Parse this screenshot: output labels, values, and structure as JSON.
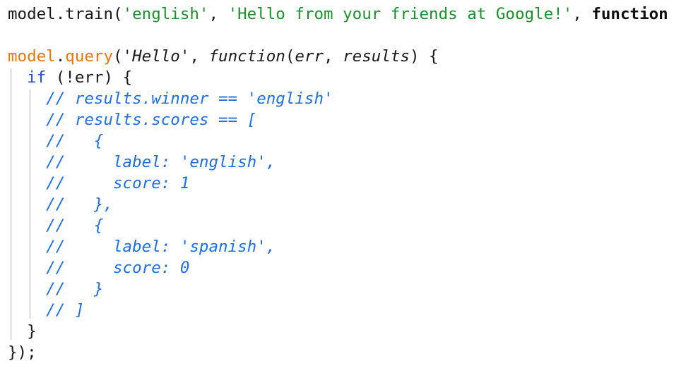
{
  "editor": {
    "lines": [
      {
        "parts": [
          {
            "text": "model.train(",
            "style": "plain"
          },
          {
            "text": "'english'",
            "style": "str"
          },
          {
            "text": ", ",
            "style": "plain"
          },
          {
            "text": "'Hello from your friends at Google!'",
            "style": "str"
          },
          {
            "text": ", ",
            "style": "plain"
          },
          {
            "text": "function",
            "style": "bold"
          }
        ]
      },
      {
        "parts": []
      },
      {
        "parts": [
          {
            "text": "model",
            "style": "fn-call"
          },
          {
            "text": ".",
            "style": "plain"
          },
          {
            "text": "query",
            "style": "fn-call"
          },
          {
            "text": "('",
            "style": "plain"
          },
          {
            "text": "Hello",
            "style": "ital"
          },
          {
            "text": "', ",
            "style": "plain"
          },
          {
            "text": "function",
            "style": "ital"
          },
          {
            "text": "(",
            "style": "plain"
          },
          {
            "text": "err",
            "style": "ital"
          },
          {
            "text": ", ",
            "style": "plain"
          },
          {
            "text": "results",
            "style": "ital"
          },
          {
            "text": ") {",
            "style": "plain"
          }
        ]
      },
      {
        "parts": [
          {
            "text": "  ",
            "style": "plain"
          },
          {
            "text": "if",
            "style": "kw"
          },
          {
            "text": " (!err) {",
            "style": "plain"
          }
        ]
      },
      {
        "parts": [
          {
            "text": "    // results.winner == 'english'",
            "style": "cmt"
          }
        ]
      },
      {
        "parts": [
          {
            "text": "    // results.scores == [",
            "style": "cmt"
          }
        ]
      },
      {
        "parts": [
          {
            "text": "    //   {",
            "style": "cmt"
          }
        ]
      },
      {
        "parts": [
          {
            "text": "    //     label: 'english',",
            "style": "cmt"
          }
        ]
      },
      {
        "parts": [
          {
            "text": "    //     score: 1",
            "style": "cmt"
          }
        ]
      },
      {
        "parts": [
          {
            "text": "    //   },",
            "style": "cmt"
          }
        ]
      },
      {
        "parts": [
          {
            "text": "    //   {",
            "style": "cmt"
          }
        ]
      },
      {
        "parts": [
          {
            "text": "    //     label: 'spanish',",
            "style": "cmt"
          }
        ]
      },
      {
        "parts": [
          {
            "text": "    //     score: 0",
            "style": "cmt"
          }
        ]
      },
      {
        "parts": [
          {
            "text": "    //   }",
            "style": "cmt"
          }
        ]
      },
      {
        "parts": [
          {
            "text": "    // ]",
            "style": "cmt"
          }
        ]
      },
      {
        "parts": [
          {
            "text": "  }",
            "style": "plain"
          }
        ]
      },
      {
        "parts": [
          {
            "text": "});",
            "style": "plain"
          }
        ]
      }
    ]
  }
}
